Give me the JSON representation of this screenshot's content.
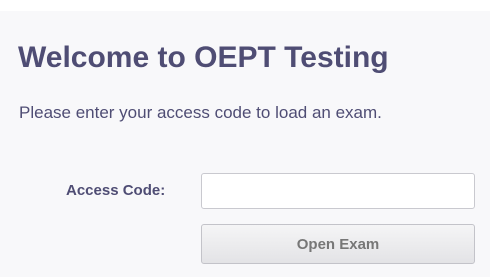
{
  "page": {
    "title": "Welcome to OEPT Testing",
    "subtitle": "Please enter your access code to load an exam."
  },
  "form": {
    "access_code_label": "Access Code:",
    "access_code_value": "",
    "access_code_placeholder": "",
    "open_exam_label": "Open Exam"
  },
  "colors": {
    "text_primary": "#4f4d74",
    "panel_background": "#f8f8fa",
    "button_text": "#777777"
  }
}
